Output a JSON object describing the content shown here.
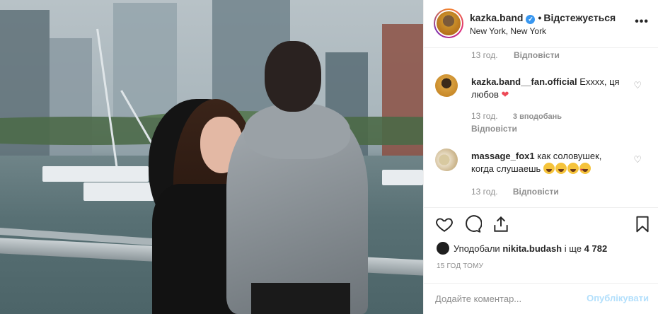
{
  "post": {
    "username": "kazka.band",
    "follow_status": "Відстежується",
    "separator": "•",
    "location": "New York, New York",
    "more_label": "•••"
  },
  "comments": {
    "top_meta": {
      "time": "13 год.",
      "reply": "Відповісти"
    },
    "items": [
      {
        "username": "kazka.band__fan.official",
        "text": "Exxxx, ця любов",
        "time": "13 год.",
        "likes": "3 вподобань",
        "reply": "Відповісти"
      },
      {
        "username": "massage_fox1",
        "text": "как соловушек, когда слушаешь",
        "time": "13 год.",
        "reply": "Відповісти"
      }
    ]
  },
  "likes": {
    "prefix": "Уподобали",
    "user": "nikita.budash",
    "middle": "і ще",
    "count": "4 782"
  },
  "time_ago": "15 ГОД ТОМУ",
  "comment_box": {
    "placeholder": "Додайте коментар...",
    "post_label": "Опублікувати"
  },
  "colors": {
    "verified": "#3897f0",
    "heart": "#ed4956",
    "post_button_disabled": "#b2dffc",
    "muted": "#8e8e8e"
  }
}
